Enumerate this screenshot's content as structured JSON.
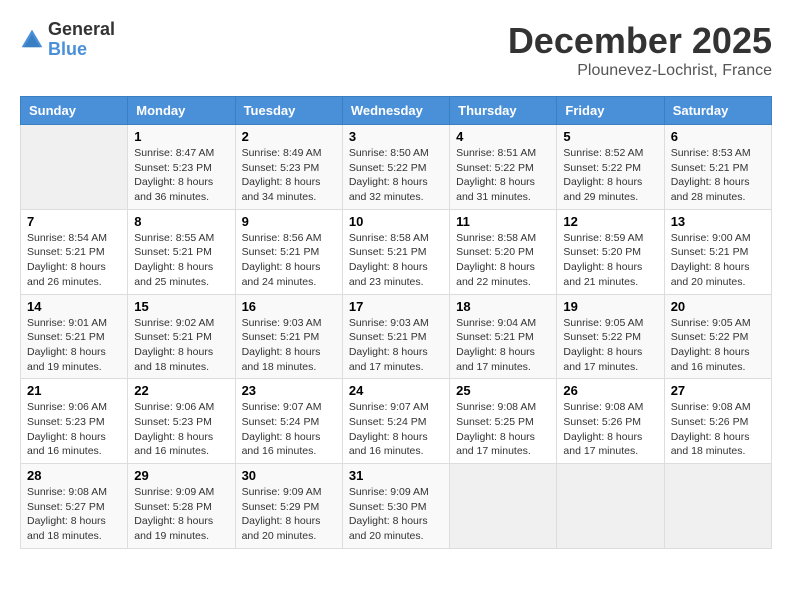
{
  "header": {
    "logo_general": "General",
    "logo_blue": "Blue",
    "month_title": "December 2025",
    "location": "Plounevez-Lochrist, France"
  },
  "calendar": {
    "weekdays": [
      "Sunday",
      "Monday",
      "Tuesday",
      "Wednesday",
      "Thursday",
      "Friday",
      "Saturday"
    ],
    "weeks": [
      [
        {
          "day": "",
          "info": ""
        },
        {
          "day": "1",
          "info": "Sunrise: 8:47 AM\nSunset: 5:23 PM\nDaylight: 8 hours\nand 36 minutes."
        },
        {
          "day": "2",
          "info": "Sunrise: 8:49 AM\nSunset: 5:23 PM\nDaylight: 8 hours\nand 34 minutes."
        },
        {
          "day": "3",
          "info": "Sunrise: 8:50 AM\nSunset: 5:22 PM\nDaylight: 8 hours\nand 32 minutes."
        },
        {
          "day": "4",
          "info": "Sunrise: 8:51 AM\nSunset: 5:22 PM\nDaylight: 8 hours\nand 31 minutes."
        },
        {
          "day": "5",
          "info": "Sunrise: 8:52 AM\nSunset: 5:22 PM\nDaylight: 8 hours\nand 29 minutes."
        },
        {
          "day": "6",
          "info": "Sunrise: 8:53 AM\nSunset: 5:21 PM\nDaylight: 8 hours\nand 28 minutes."
        }
      ],
      [
        {
          "day": "7",
          "info": "Sunrise: 8:54 AM\nSunset: 5:21 PM\nDaylight: 8 hours\nand 26 minutes."
        },
        {
          "day": "8",
          "info": "Sunrise: 8:55 AM\nSunset: 5:21 PM\nDaylight: 8 hours\nand 25 minutes."
        },
        {
          "day": "9",
          "info": "Sunrise: 8:56 AM\nSunset: 5:21 PM\nDaylight: 8 hours\nand 24 minutes."
        },
        {
          "day": "10",
          "info": "Sunrise: 8:58 AM\nSunset: 5:21 PM\nDaylight: 8 hours\nand 23 minutes."
        },
        {
          "day": "11",
          "info": "Sunrise: 8:58 AM\nSunset: 5:20 PM\nDaylight: 8 hours\nand 22 minutes."
        },
        {
          "day": "12",
          "info": "Sunrise: 8:59 AM\nSunset: 5:20 PM\nDaylight: 8 hours\nand 21 minutes."
        },
        {
          "day": "13",
          "info": "Sunrise: 9:00 AM\nSunset: 5:21 PM\nDaylight: 8 hours\nand 20 minutes."
        }
      ],
      [
        {
          "day": "14",
          "info": "Sunrise: 9:01 AM\nSunset: 5:21 PM\nDaylight: 8 hours\nand 19 minutes."
        },
        {
          "day": "15",
          "info": "Sunrise: 9:02 AM\nSunset: 5:21 PM\nDaylight: 8 hours\nand 18 minutes."
        },
        {
          "day": "16",
          "info": "Sunrise: 9:03 AM\nSunset: 5:21 PM\nDaylight: 8 hours\nand 18 minutes."
        },
        {
          "day": "17",
          "info": "Sunrise: 9:03 AM\nSunset: 5:21 PM\nDaylight: 8 hours\nand 17 minutes."
        },
        {
          "day": "18",
          "info": "Sunrise: 9:04 AM\nSunset: 5:21 PM\nDaylight: 8 hours\nand 17 minutes."
        },
        {
          "day": "19",
          "info": "Sunrise: 9:05 AM\nSunset: 5:22 PM\nDaylight: 8 hours\nand 17 minutes."
        },
        {
          "day": "20",
          "info": "Sunrise: 9:05 AM\nSunset: 5:22 PM\nDaylight: 8 hours\nand 16 minutes."
        }
      ],
      [
        {
          "day": "21",
          "info": "Sunrise: 9:06 AM\nSunset: 5:23 PM\nDaylight: 8 hours\nand 16 minutes."
        },
        {
          "day": "22",
          "info": "Sunrise: 9:06 AM\nSunset: 5:23 PM\nDaylight: 8 hours\nand 16 minutes."
        },
        {
          "day": "23",
          "info": "Sunrise: 9:07 AM\nSunset: 5:24 PM\nDaylight: 8 hours\nand 16 minutes."
        },
        {
          "day": "24",
          "info": "Sunrise: 9:07 AM\nSunset: 5:24 PM\nDaylight: 8 hours\nand 16 minutes."
        },
        {
          "day": "25",
          "info": "Sunrise: 9:08 AM\nSunset: 5:25 PM\nDaylight: 8 hours\nand 17 minutes."
        },
        {
          "day": "26",
          "info": "Sunrise: 9:08 AM\nSunset: 5:26 PM\nDaylight: 8 hours\nand 17 minutes."
        },
        {
          "day": "27",
          "info": "Sunrise: 9:08 AM\nSunset: 5:26 PM\nDaylight: 8 hours\nand 18 minutes."
        }
      ],
      [
        {
          "day": "28",
          "info": "Sunrise: 9:08 AM\nSunset: 5:27 PM\nDaylight: 8 hours\nand 18 minutes."
        },
        {
          "day": "29",
          "info": "Sunrise: 9:09 AM\nSunset: 5:28 PM\nDaylight: 8 hours\nand 19 minutes."
        },
        {
          "day": "30",
          "info": "Sunrise: 9:09 AM\nSunset: 5:29 PM\nDaylight: 8 hours\nand 20 minutes."
        },
        {
          "day": "31",
          "info": "Sunrise: 9:09 AM\nSunset: 5:30 PM\nDaylight: 8 hours\nand 20 minutes."
        },
        {
          "day": "",
          "info": ""
        },
        {
          "day": "",
          "info": ""
        },
        {
          "day": "",
          "info": ""
        }
      ]
    ]
  }
}
